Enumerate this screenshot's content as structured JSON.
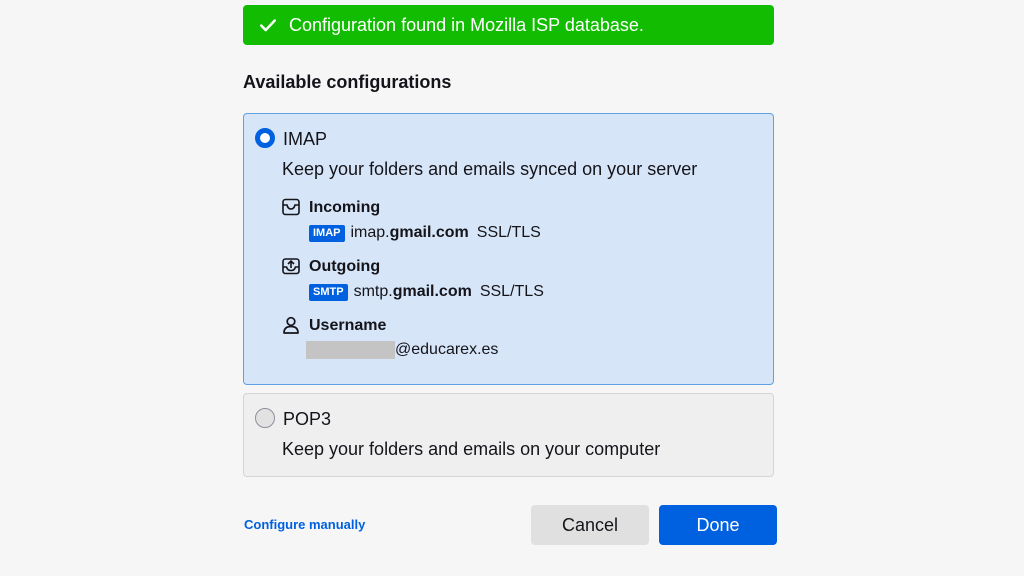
{
  "banner": {
    "text": "Configuration found in Mozilla ISP database.",
    "icon": "check-icon",
    "color": "#12bc00"
  },
  "section_title": "Available configurations",
  "imap": {
    "title": "IMAP",
    "description": "Keep your folders and emails synced on your server",
    "selected": true,
    "incoming": {
      "label": "Incoming",
      "icon": "inbox-icon",
      "protocol": "IMAP",
      "host_prefix": "imap.",
      "host_domain": "gmail.com",
      "security": "SSL/TLS"
    },
    "outgoing": {
      "label": "Outgoing",
      "icon": "outbox-icon",
      "protocol": "SMTP",
      "host_prefix": "smtp.",
      "host_domain": "gmail.com",
      "security": "SSL/TLS"
    },
    "username": {
      "label": "Username",
      "icon": "user-icon",
      "domain": "@educarex.es"
    }
  },
  "pop3": {
    "title": "POP3",
    "description": "Keep your folders and emails on your computer",
    "selected": false
  },
  "footer": {
    "configure_manually": "Configure manually",
    "cancel": "Cancel",
    "done": "Done"
  },
  "colors": {
    "accent": "#0061e0",
    "success": "#12bc00"
  }
}
